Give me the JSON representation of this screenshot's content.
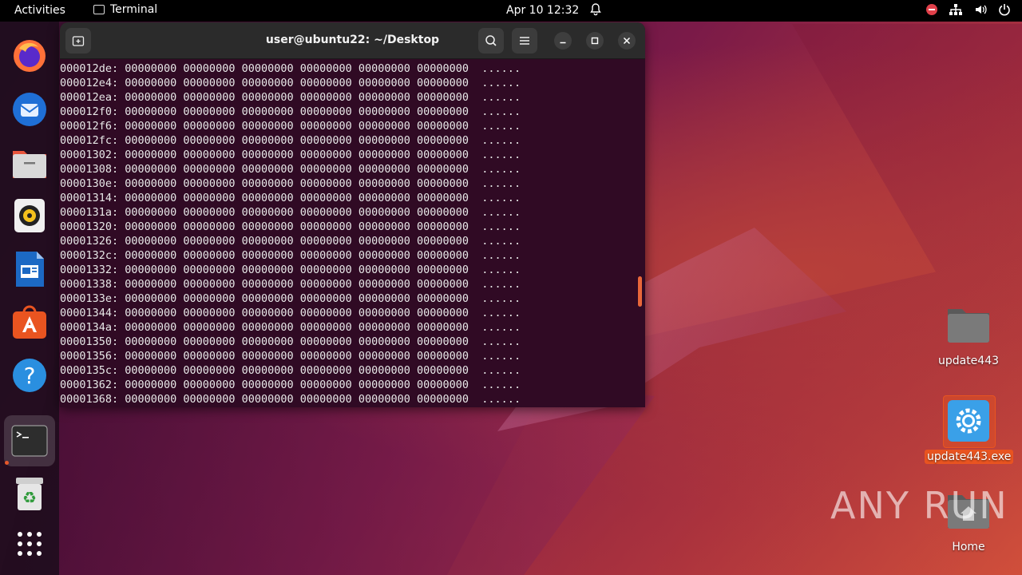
{
  "topbar": {
    "activities": "Activities",
    "app_name": "Terminal",
    "clock": "Apr 10  12:32"
  },
  "dock": {
    "items": [
      {
        "name": "firefox",
        "icon": "firefox-icon"
      },
      {
        "name": "thunderbird",
        "icon": "thunderbird-icon"
      },
      {
        "name": "files",
        "icon": "files-icon"
      },
      {
        "name": "rhythmbox",
        "icon": "rhythmbox-icon"
      },
      {
        "name": "libreoffice-writer",
        "icon": "writer-icon"
      },
      {
        "name": "app-center",
        "icon": "app-center-icon"
      },
      {
        "name": "help",
        "icon": "help-icon"
      },
      {
        "name": "terminal",
        "icon": "terminal-icon"
      },
      {
        "name": "trash",
        "icon": "trash-icon"
      },
      {
        "name": "show-apps",
        "icon": "app-grid-icon"
      }
    ]
  },
  "terminal": {
    "title": "user@ubuntu22: ~/Desktop",
    "lines": [
      "000012de: 00000000 00000000 00000000 00000000 00000000 00000000  ......",
      "000012e4: 00000000 00000000 00000000 00000000 00000000 00000000  ......",
      "000012ea: 00000000 00000000 00000000 00000000 00000000 00000000  ......",
      "000012f0: 00000000 00000000 00000000 00000000 00000000 00000000  ......",
      "000012f6: 00000000 00000000 00000000 00000000 00000000 00000000  ......",
      "000012fc: 00000000 00000000 00000000 00000000 00000000 00000000  ......",
      "00001302: 00000000 00000000 00000000 00000000 00000000 00000000  ......",
      "00001308: 00000000 00000000 00000000 00000000 00000000 00000000  ......",
      "0000130e: 00000000 00000000 00000000 00000000 00000000 00000000  ......",
      "00001314: 00000000 00000000 00000000 00000000 00000000 00000000  ......",
      "0000131a: 00000000 00000000 00000000 00000000 00000000 00000000  ......",
      "00001320: 00000000 00000000 00000000 00000000 00000000 00000000  ......",
      "00001326: 00000000 00000000 00000000 00000000 00000000 00000000  ......",
      "0000132c: 00000000 00000000 00000000 00000000 00000000 00000000  ......",
      "00001332: 00000000 00000000 00000000 00000000 00000000 00000000  ......",
      "00001338: 00000000 00000000 00000000 00000000 00000000 00000000  ......",
      "0000133e: 00000000 00000000 00000000 00000000 00000000 00000000  ......",
      "00001344: 00000000 00000000 00000000 00000000 00000000 00000000  ......",
      "0000134a: 00000000 00000000 00000000 00000000 00000000 00000000  ......",
      "00001350: 00000000 00000000 00000000 00000000 00000000 00000000  ......",
      "00001356: 00000000 00000000 00000000 00000000 00000000 00000000  ......",
      "0000135c: 00000000 00000000 00000000 00000000 00000000 00000000  ......",
      "00001362: 00000000 00000000 00000000 00000000 00000000 00000000  ......",
      "00001368: 00000000 00000000 00000000 00000000 00000000 00000000  ......"
    ]
  },
  "desktop": {
    "icons": [
      {
        "label": "update443"
      },
      {
        "label": "update443.exe"
      },
      {
        "label": "Home"
      }
    ]
  },
  "watermark": "ANY RUN",
  "colors": {
    "accent": "#e95420",
    "terminal_bg": "#300a24",
    "header_bg": "#2b2b2b"
  }
}
